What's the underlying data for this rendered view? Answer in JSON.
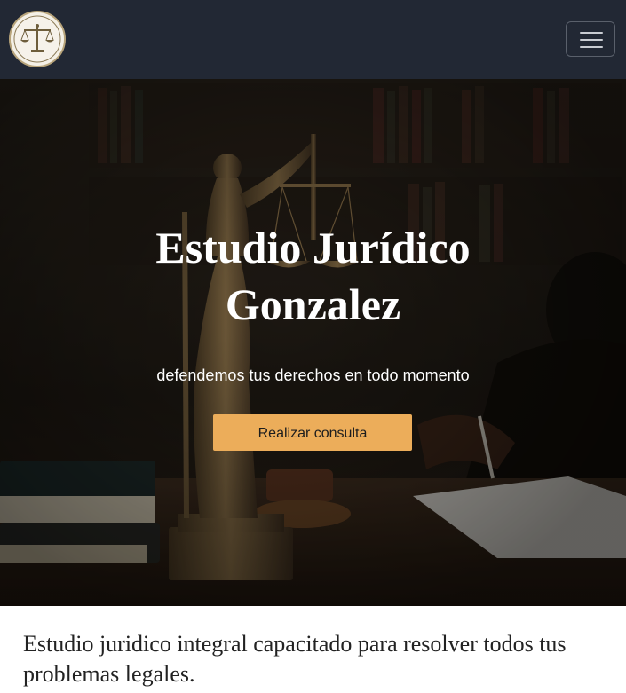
{
  "navbar": {
    "logo_icon": "scales-of-justice-icon",
    "menu_icon": "hamburger-menu-icon",
    "background": "#222834"
  },
  "hero": {
    "title_line1": "Estudio Jurídico",
    "title_line2": "Gonzalez",
    "subtitle": "defendemos tus derechos en todo momento",
    "cta_label": "Realizar consulta",
    "cta_color": "#ecad5a"
  },
  "intro": {
    "text": "Estudio juridico integral capacitado para resolver todos tus problemas legales."
  }
}
